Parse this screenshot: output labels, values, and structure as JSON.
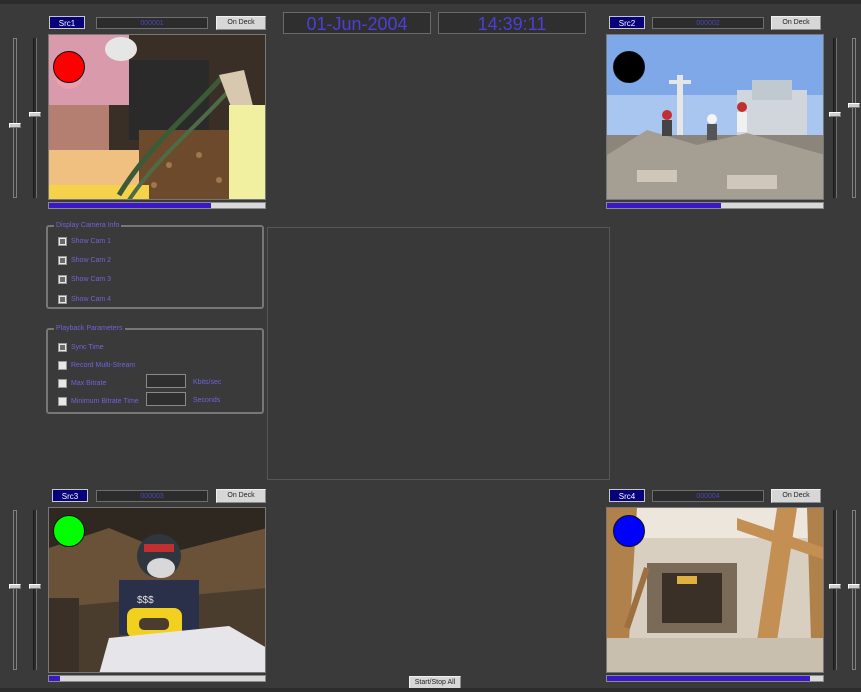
{
  "header": {
    "date": "01-Jun-2004",
    "time": "14:39:11"
  },
  "feeds": [
    {
      "label": "Src1",
      "field": "000001",
      "button": "On Deck",
      "dot_color": "#ff0000",
      "progress": 0.75
    },
    {
      "label": "Src2",
      "field": "000002",
      "button": "On Deck",
      "dot_color": "#000000",
      "progress": 0.53
    },
    {
      "label": "Src3",
      "field": "000003",
      "button": "On Deck",
      "dot_color": "#00ff00",
      "progress": 0.05
    },
    {
      "label": "Src4",
      "field": "000004",
      "button": "On Deck",
      "dot_color": "#0000ff",
      "progress": 0.94
    }
  ],
  "sliders": {
    "left_top": {
      "outer": 0.55,
      "inner": 0.48
    },
    "right_top": {
      "outer": 0.42,
      "inner": 0.48
    },
    "left_bottom": {
      "outer": 0.48,
      "inner": 0.48
    },
    "right_bottom": {
      "outer": 0.48,
      "inner": 0.48
    }
  },
  "display_options": {
    "title": "Display Camera Info",
    "items": [
      {
        "label": "Show Cam 1",
        "checked": true
      },
      {
        "label": "Show Cam 2",
        "checked": true
      },
      {
        "label": "Show Cam 3",
        "checked": true
      },
      {
        "label": "Show Cam 4",
        "checked": true
      }
    ]
  },
  "playback": {
    "title": "Playback Parameters",
    "items": [
      {
        "label": "Sync Time",
        "checked": true
      },
      {
        "label": "Record Multi-Stream",
        "checked": false
      },
      {
        "label": "Max Bitrate",
        "checked": false,
        "unit": "Kbits/sec"
      },
      {
        "label": "Minimum Bitrate Time",
        "checked": false,
        "unit": "Seconds"
      }
    ]
  },
  "footer": {
    "stop_button": "Start/Stop All"
  }
}
